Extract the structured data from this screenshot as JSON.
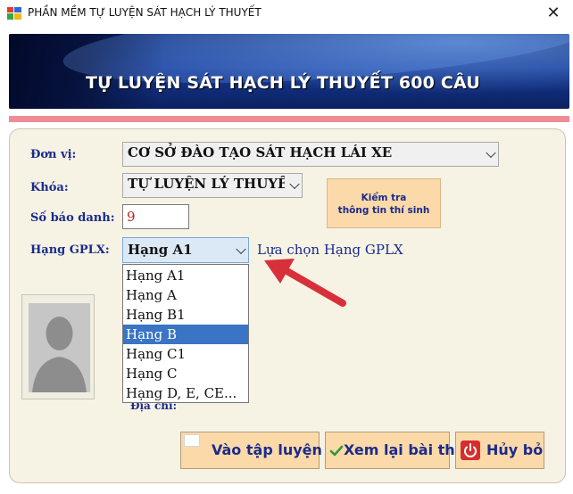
{
  "window": {
    "title": "PHẦN MỀM TỰ LUYỆN SÁT HẠCH LÝ THUYẾT",
    "close_glyph": "✕"
  },
  "banner": {
    "title": "TỰ LUYỆN SÁT HẠCH LÝ THUYẾT 600 CÂU"
  },
  "form": {
    "don_vi_label": "Đơn vị:",
    "don_vi_value": "CƠ SỞ ĐÀO TẠO SÁT HẠCH LÁI XE",
    "khoa_label": "Khóa:",
    "khoa_value": "TỰ LUYỆN LÝ THUYẾT",
    "so_bao_danh_label": "Số báo danh:",
    "so_bao_danh_value": "9",
    "hang_label": "Hạng GPLX:",
    "hang_value": "Hạng A1",
    "hang_hint": "Lựa chọn Hạng GPLX",
    "hang_options": [
      "Hạng A1",
      "Hạng A",
      "Hạng B1",
      "Hạng B",
      "Hạng C1",
      "Hạng C",
      "Hạng D, E, CE..."
    ],
    "hang_selected_index": 3,
    "dia_chi_label": "Địa chỉ:"
  },
  "buttons": {
    "check_line1": "Kiểm tra",
    "check_line2": "thông tin thí sinh",
    "practice": "Vào tập luyện",
    "review": "Xem lại bài thi",
    "cancel": "Hủy bỏ"
  },
  "colors": {
    "label_blue": "#1a2b8c",
    "button_peach": "#fbd9a8",
    "selected_blue": "#3a74c4",
    "arrow_red": "#d8303a",
    "panel_bg": "#f6f3e4"
  },
  "icons": {
    "app": "app-logo-icon",
    "review": "checkmark-icon",
    "cancel": "power-icon",
    "practice": "blank-square-icon"
  }
}
